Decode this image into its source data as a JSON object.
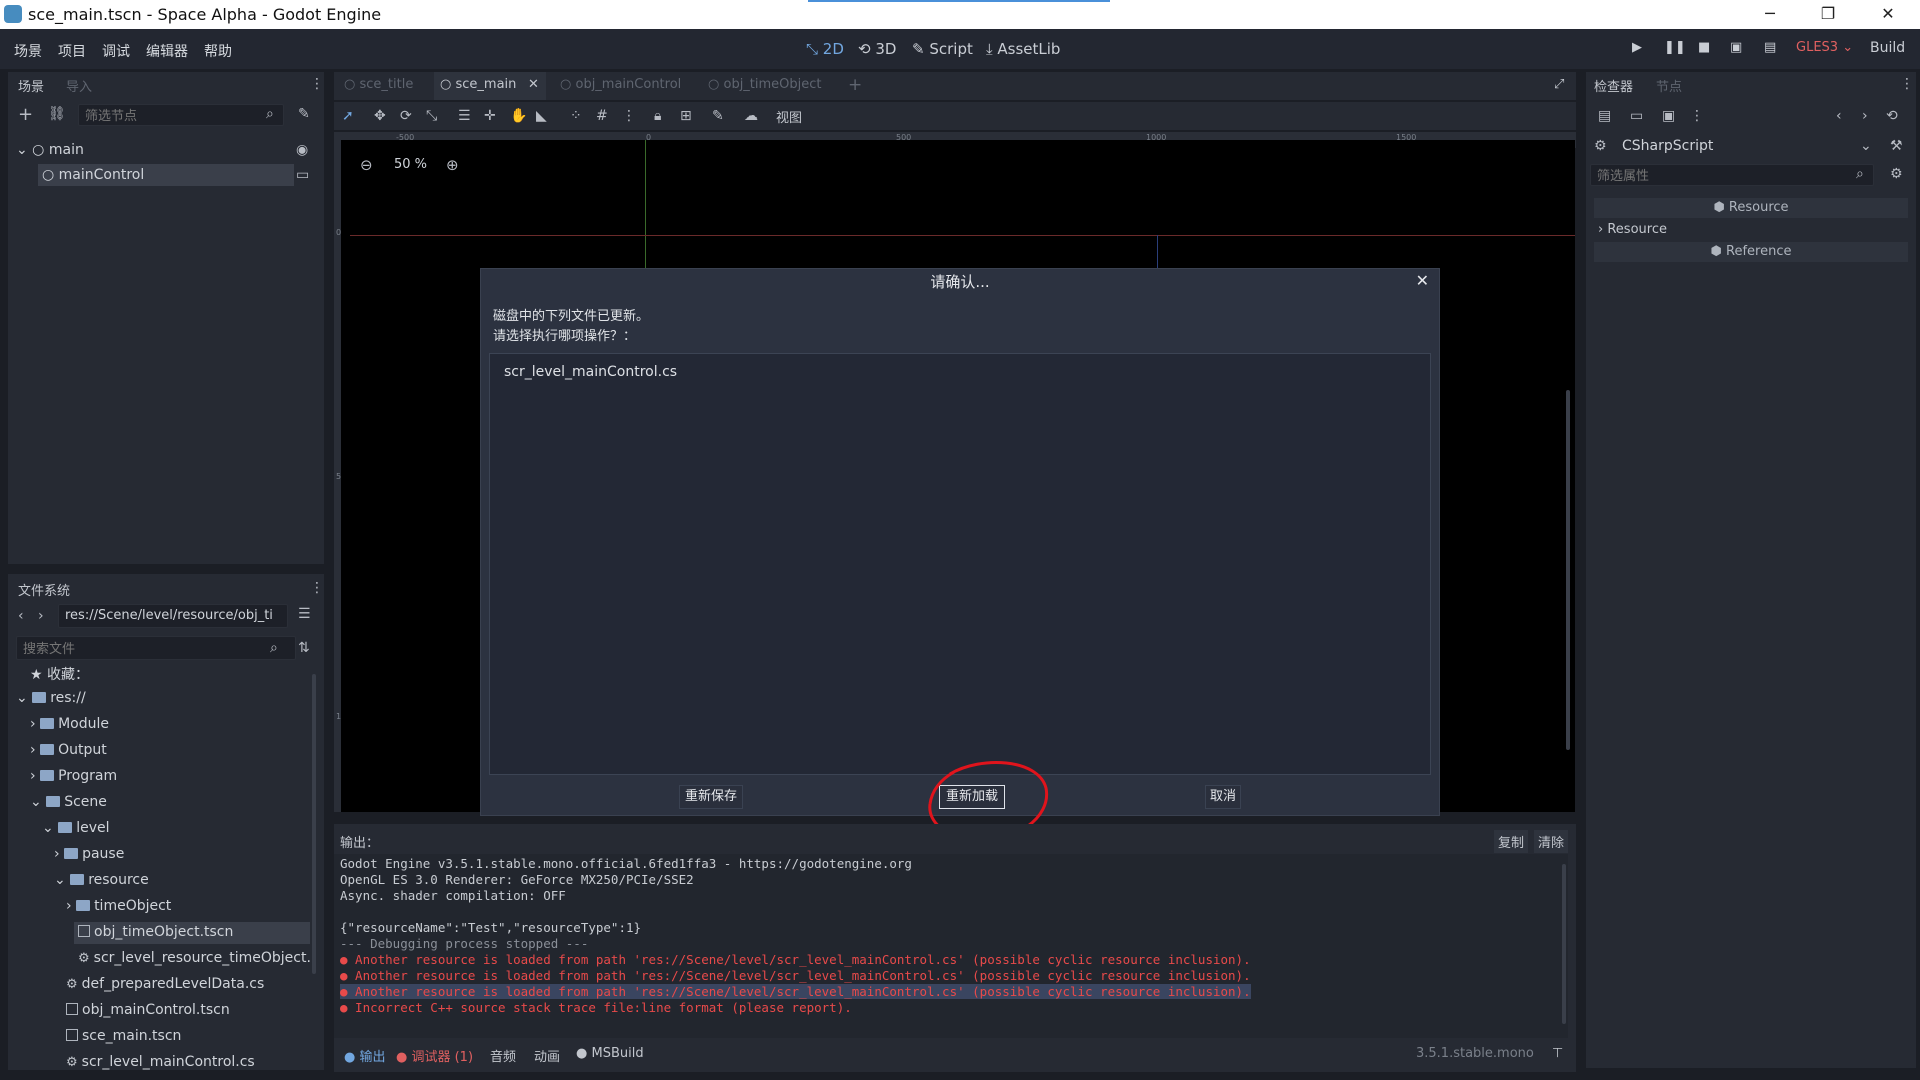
{
  "window": {
    "title": "sce_main.tscn - Space Alpha - Godot Engine",
    "min": "─",
    "max": "❐",
    "close": "✕"
  },
  "menu": {
    "items": [
      "场景",
      "项目",
      "调试",
      "编辑器",
      "帮助"
    ]
  },
  "modes": {
    "m2d": "2D",
    "m3d": "3D",
    "script": "Script",
    "assetlib": "AssetLib"
  },
  "play": {
    "renderer": "GLES3",
    "build": "Build"
  },
  "scene_dock": {
    "tab_scene": "场景",
    "tab_import": "导入",
    "filter_placeholder": "筛选节点",
    "nodes": [
      "main",
      "mainControl"
    ]
  },
  "fs_dock": {
    "title": "文件系统",
    "path": "res://Scene/level/resource/obj_ti",
    "search_placeholder": "搜索文件",
    "items": [
      "收藏：",
      "res://",
      "Module",
      "Output",
      "Program",
      "Scene",
      "level",
      "pause",
      "resource",
      "timeObject",
      "obj_timeObject.tscn",
      "scr_level_resource_timeObject.",
      "def_preparedLevelData.cs",
      "obj_mainControl.tscn",
      "sce_main.tscn",
      "scr_level_mainControl.cs"
    ]
  },
  "editor_tabs": [
    "sce_title",
    "sce_main",
    "obj_mainControl",
    "obj_timeObject"
  ],
  "toolbar": {
    "view": "视图"
  },
  "zoom": {
    "level": "50 %"
  },
  "rulers": {
    "h": [
      "-500",
      "0",
      "500",
      "1000",
      "1500"
    ],
    "v": [
      "0",
      "500",
      "1000"
    ]
  },
  "dialog": {
    "title": "请确认...",
    "line1": "磁盘中的下列文件已更新。",
    "line2": "请选择执行哪项操作？：",
    "file": "scr_level_mainControl.cs",
    "resave": "重新保存",
    "reload": "重新加载",
    "cancel": "取消"
  },
  "output": {
    "label": "输出：",
    "copy": "复制",
    "clear": "清除",
    "lines": [
      "Godot Engine v3.5.1.stable.mono.official.6fed1ffa3 - https://godotengine.org",
      "OpenGL ES 3.0 Renderer: GeForce MX250/PCIe/SSE2",
      "Async. shader compilation: OFF",
      "{\"resourceName\":\"Test\",\"resourceType\":1}",
      "--- Debugging process stopped ---",
      "● Another resource is loaded from path 'res://Scene/level/scr_level_mainControl.cs' (possible cyclic resource inclusion).",
      "● Another resource is loaded from path 'res://Scene/level/scr_level_mainControl.cs' (possible cyclic resource inclusion).",
      "● Another resource is loaded from path 'res://Scene/level/scr_level_mainControl.cs' (possible cyclic resource inclusion).",
      "● Incorrect C++ source stack trace file:line format (please report)."
    ],
    "tabs": [
      "● 输出",
      "● 调试器 (1)",
      "音频",
      "动画",
      "● MSBuild"
    ],
    "version": "3.5.1.stable.mono"
  },
  "inspector": {
    "tab_inspector": "检查器",
    "tab_node": "节点",
    "object": "CSharpScript",
    "filter_placeholder": "筛选属性",
    "sec1": "Resource",
    "sub1": "Resource",
    "sec2": "Reference"
  },
  "colors": {
    "accent": "#72a7e0",
    "error": "#e84a4a",
    "annotation": "#e0141c"
  }
}
